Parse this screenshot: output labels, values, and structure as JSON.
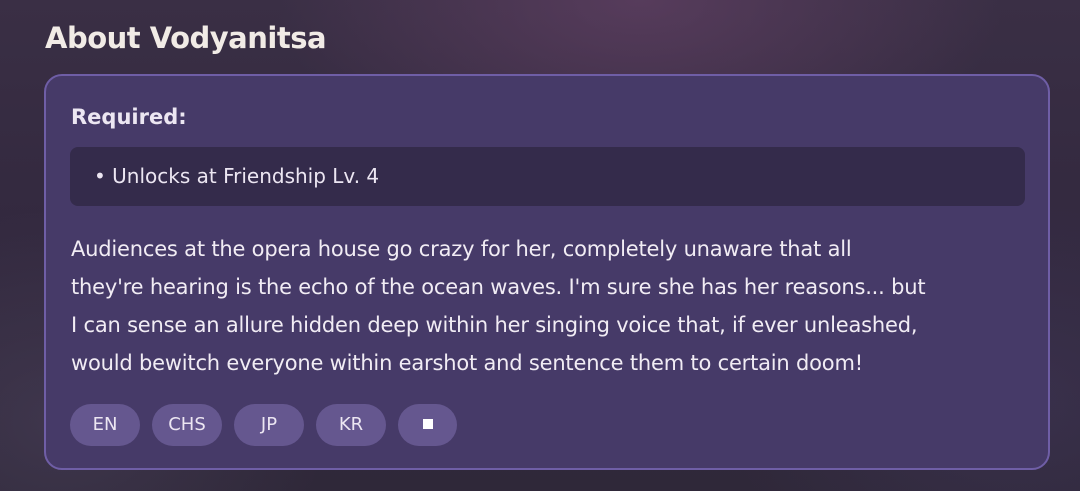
{
  "page": {
    "title": "About Vodyanitsa"
  },
  "requirements": {
    "label": "Required:",
    "items": [
      {
        "text": "• Unlocks at Friendship Lv. 4"
      }
    ]
  },
  "description": {
    "lines": [
      "Audiences at the opera house go crazy for her, completely unaware that all",
      "they're hearing is the echo of the ocean waves. I'm sure she has her reasons... but",
      "I can sense an allure hidden deep within her singing voice that, if ever unleashed,",
      "would bewitch everyone within earshot and sentence them to certain doom!"
    ]
  },
  "voice_languages": {
    "buttons": [
      {
        "label": "EN"
      },
      {
        "label": "CHS"
      },
      {
        "label": "JP"
      },
      {
        "label": "KR"
      }
    ],
    "stop_button": {
      "icon": "stop-icon"
    }
  },
  "colors": {
    "card_background": "#463a68",
    "card_border": "#6f5ea6",
    "requirement_box": "#342b4b",
    "pill_button": "#65578f",
    "text": "#f1ecf4"
  }
}
